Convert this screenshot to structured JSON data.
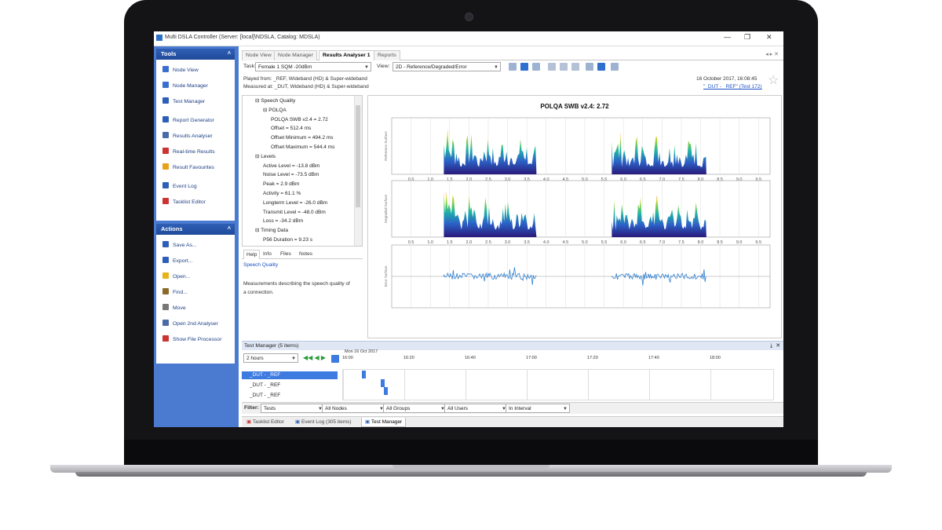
{
  "window": {
    "title": "Multi DSLA Controller (Server: [local]\\NDSLA, Catalog: MDSLA)"
  },
  "tools": {
    "header": "Tools",
    "items": [
      {
        "label": "Node View",
        "icon": "node-view-icon",
        "color": "#3a6fd0"
      },
      {
        "label": "Node Manager",
        "icon": "node-manager-icon",
        "color": "#3a6fd0"
      },
      {
        "label": "Test Manager",
        "icon": "test-manager-icon",
        "color": "#2d5fb8"
      },
      {
        "label": "Report Generator",
        "icon": "report-icon",
        "color": "#2d5fb8"
      },
      {
        "label": "Results Analyser",
        "icon": "analyser-icon",
        "color": "#4a6aa8"
      },
      {
        "label": "Real-time Results",
        "icon": "realtime-icon",
        "color": "#cc3333"
      },
      {
        "label": "Result Favourites",
        "icon": "star-icon",
        "color": "#e8a21a"
      },
      {
        "label": "Event Log",
        "icon": "event-log-icon",
        "color": "#2d5fb8"
      },
      {
        "label": "Tasklist Editor",
        "icon": "tasklist-icon",
        "color": "#cc3333"
      }
    ]
  },
  "actions": {
    "header": "Actions",
    "items": [
      {
        "label": "Save As...",
        "icon": "save-icon",
        "color": "#2d5fb8"
      },
      {
        "label": "Export...",
        "icon": "export-icon",
        "color": "#2d5fb8"
      },
      {
        "label": "Open...",
        "icon": "folder-icon",
        "color": "#e8b31a"
      },
      {
        "label": "Find...",
        "icon": "find-icon",
        "color": "#8a6a2a"
      },
      {
        "label": "Move",
        "icon": "move-icon",
        "color": "#777777"
      },
      {
        "label": "Open 2nd Analyser",
        "icon": "analyser-icon",
        "color": "#4a6aa8"
      },
      {
        "label": "Show File Processor",
        "icon": "file-processor-icon",
        "color": "#cc3333"
      }
    ]
  },
  "tabs": [
    "Node View",
    "Node Manager",
    "Results Analyser 1",
    "Reports"
  ],
  "toolbar": {
    "task_label": "Task:",
    "task_value": "Female 1 SQM -20dBm",
    "view_label": "View:",
    "view_value": "2D - Reference/Degraded/Error"
  },
  "info": {
    "played_from": "Played from: _REF, Wideband (HD) & Super-wideband",
    "measured_at": "Measured at: _DUT, Wideband (HD) & Super-wideband",
    "date": "16 October 2017, 16:08:45",
    "test_link": "\"_DUT - _REF\" (Test 172)"
  },
  "tree": [
    {
      "text": "Speech Quality",
      "level": 0,
      "expander": "⊟"
    },
    {
      "text": "POLQA",
      "level": 1,
      "expander": "⊟"
    },
    {
      "text": "POLQA SWB v2.4 = 2.72",
      "level": 2
    },
    {
      "text": "Offset = 512.4 ms",
      "level": 2
    },
    {
      "text": "Offset Minimum = 494.2 ms",
      "level": 2
    },
    {
      "text": "Offset Maximum = 544.4 ms",
      "level": 2
    },
    {
      "text": "Levels",
      "level": 0,
      "expander": "⊟"
    },
    {
      "text": "Active Level = -13.8 dBm",
      "level": 1
    },
    {
      "text": "Noise Level = -73.5 dBm",
      "level": 1
    },
    {
      "text": "Peak = 2.9 dBm",
      "level": 1
    },
    {
      "text": "Activity = 61.1 %",
      "level": 1
    },
    {
      "text": "Longterm Level = -26.0 dBm",
      "level": 1
    },
    {
      "text": "Transmit Level = -48.0 dBm",
      "level": 1
    },
    {
      "text": "Loss = -34.2 dBm",
      "level": 1
    },
    {
      "text": "Timing Data",
      "level": 0,
      "expander": "⊟"
    },
    {
      "text": "P56 Duration = 9.23 s",
      "level": 1
    }
  ],
  "help": {
    "tabs": [
      "Help",
      "Info",
      "Files",
      "Notes"
    ],
    "title": "Speech Quality",
    "text1": "Measurements describing the speech quality of",
    "text2": "a connection."
  },
  "chart": {
    "title": "POLQA SWB v2.4: 2.72",
    "panel_labels": [
      "Reference Surface",
      "Degraded Surface",
      "Error Surface"
    ],
    "ticks": [
      "0.5",
      "1.0",
      "1.5",
      "2.0",
      "2.5",
      "3.0",
      "3.5",
      "4.0",
      "4.5",
      "5.0",
      "5.5",
      "6.0",
      "6.5",
      "7.0",
      "7.5",
      "8.0",
      "8.5",
      "9.0",
      "9.5"
    ]
  },
  "chart_data": {
    "type": "area",
    "title": "POLQA SWB v2.4: 2.72",
    "xlim": [
      0,
      9.8
    ],
    "series": [
      {
        "name": "Reference Surface",
        "segments": [
          [
            1.35,
            3.75
          ],
          [
            5.7,
            8.15
          ]
        ]
      },
      {
        "name": "Degraded Surface",
        "segments": [
          [
            1.35,
            3.75
          ],
          [
            5.7,
            8.15
          ]
        ]
      },
      {
        "name": "Error Surface",
        "segments": [
          [
            1.35,
            3.75
          ],
          [
            5.7,
            8.15
          ]
        ]
      }
    ]
  },
  "test_manager": {
    "header": "Test Manager (5 items)",
    "range": "2 hours",
    "date_label": "Mon 16 Oct 2017",
    "times": [
      "16:00",
      "16:20",
      "16:40",
      "17:00",
      "17:20",
      "17:40",
      "18:00"
    ],
    "rows": [
      "_DUT - _REF",
      "_DUT - _REF",
      "_DUT - _REF"
    ],
    "filter_label": "Filter:",
    "filters": [
      "Tests",
      "All Nodes",
      "All Groups",
      "All Users",
      "In Interval"
    ]
  },
  "bottom_tabs": [
    "Tasklist Editor",
    "Event Log (305 items)",
    "Test Manager"
  ]
}
